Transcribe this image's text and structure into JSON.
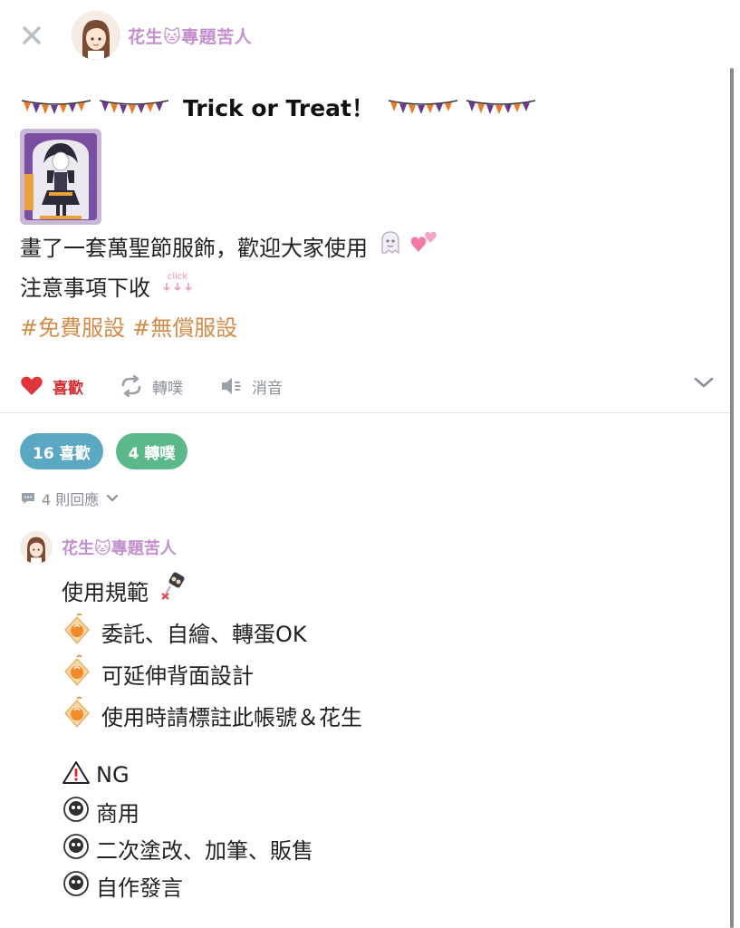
{
  "header": {
    "author_name": "花生🐱專題苦人"
  },
  "post": {
    "title": "Trick or Treat！",
    "line1": "畫了一套萬聖節服飾，歡迎大家使用",
    "line2": "注意事項下收",
    "click_label": "click",
    "hashtags": [
      "#免費服設",
      "#無償服設"
    ]
  },
  "actions": {
    "like": "喜歡",
    "replurk": "轉噗",
    "mute": "消音"
  },
  "stats": {
    "likes": "16 喜歡",
    "replurks": "4 轉噗"
  },
  "responses": {
    "label": "4 則回應"
  },
  "reply": {
    "author_name": "花生🐱專題苦人",
    "heading": "使用規範",
    "allowed": [
      "委託、自繪、轉蛋OK",
      "可延伸背面設計",
      "使用時請標註此帳號＆花生"
    ],
    "ng_label": "NG",
    "ng_items": [
      "商用",
      "二次塗改、加筆、販售",
      "自作發言"
    ]
  },
  "colors": {
    "accent": "#c48fcf",
    "hashtag": "#d38b4a",
    "like": "#d1302f",
    "likes_badge": "#5aa8c2",
    "replurks_badge": "#5bb88a"
  },
  "icons": {
    "close": "close-icon",
    "heart": "heart-icon",
    "replurk": "replurk-icon",
    "mute": "speaker-mute-icon",
    "chevron": "chevron-down-icon",
    "comment": "comment-icon",
    "warning": "warning-icon",
    "skull": "skull-icon",
    "orange": "orange-charm-icon",
    "bunting": "bunting-icon"
  }
}
